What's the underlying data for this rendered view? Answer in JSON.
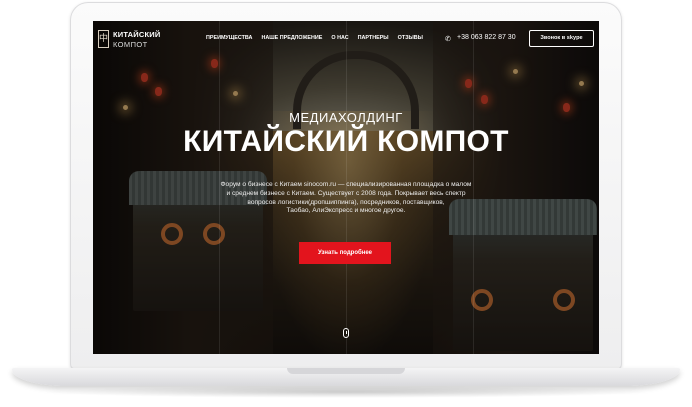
{
  "logo": {
    "mark": "中",
    "line1": "КИТАЙСКИЙ",
    "line2": "КОМПОТ"
  },
  "nav": {
    "items": [
      {
        "label": "ПРЕИМУЩЕСТВА"
      },
      {
        "label": "НАШЕ ПРЕДЛОЖЕНИЕ"
      },
      {
        "label": "О НАС"
      },
      {
        "label": "ПАРТНЕРЫ"
      },
      {
        "label": "ОТЗЫВЫ"
      }
    ]
  },
  "contact": {
    "phone_icon": "phone-icon",
    "phone": "+38 063 822 87 30",
    "skype_label": "Звонок в skype"
  },
  "hero": {
    "subtitle": "МЕДИАХОЛДИНГ",
    "title": "КИТАЙСКИЙ КОМПОТ",
    "description_lines": [
      "Форум о бизнесе с Китаем sinocom.ru — специализированная площадка о малом",
      "и среднем бизнесе с Китаем. Существует с 2008 года. Покрывает весь спектр",
      "вопросов логистики(дропшиппинга), посредников, поставщиков,",
      "Таобао, АлиЭкспресс и многое другое."
    ],
    "cta_label": "Узнать подробнее"
  },
  "colors": {
    "accent": "#e3141d",
    "text": "#ffffff",
    "laptop_frame": "#f4f4f5"
  }
}
